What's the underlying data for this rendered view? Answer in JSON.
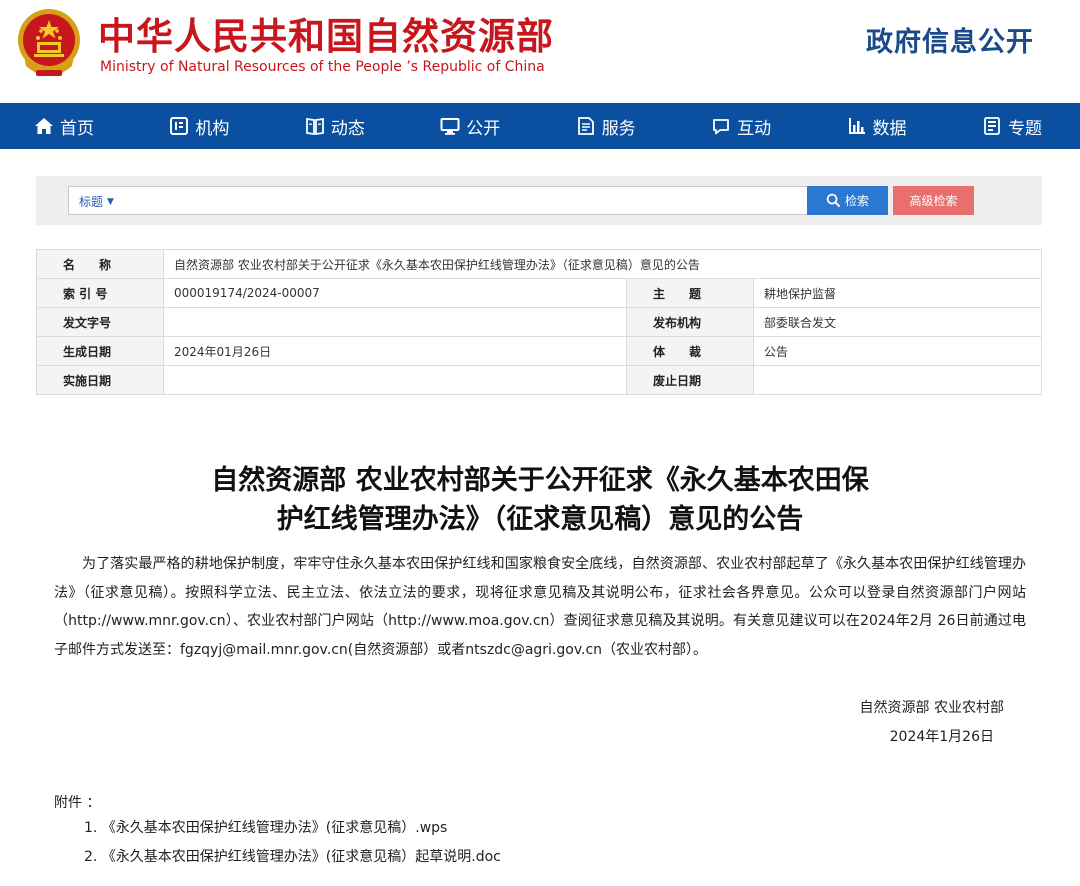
{
  "header": {
    "title": "中华人民共和国自然资源部",
    "subtitle": "Ministry of Natural Resources of the People ’s Republic of China",
    "section": "政府信息公开"
  },
  "nav": {
    "items": [
      {
        "label": "首页",
        "icon": "home-icon"
      },
      {
        "label": "机构",
        "icon": "org-icon"
      },
      {
        "label": "动态",
        "icon": "news-icon"
      },
      {
        "label": "公开",
        "icon": "monitor-icon"
      },
      {
        "label": "服务",
        "icon": "service-icon"
      },
      {
        "label": "互动",
        "icon": "chat-icon"
      },
      {
        "label": "数据",
        "icon": "chart-icon"
      },
      {
        "label": "专题",
        "icon": "topic-icon"
      }
    ]
  },
  "search": {
    "scope": "标题",
    "value": "",
    "search_label": "检索",
    "advanced_label": "高级检索"
  },
  "meta": {
    "name_key": "名　　称",
    "name_value": "自然资源部 农业农村部关于公开征求《永久基本农田保护红线管理办法》（征求意见稿）意见的公告",
    "index_key": "索 引 号",
    "index_value": "000019174/2024-00007",
    "subject_key": "主　　题",
    "subject_value": "耕地保护监督",
    "docno_key": "发文字号",
    "docno_value": "",
    "issuer_key": "发布机构",
    "issuer_value": "部委联合发文",
    "created_key": "生成日期",
    "created_value": "2024年01月26日",
    "genre_key": "体　　裁",
    "genre_value": "公告",
    "effective_key": "实施日期",
    "effective_value": "",
    "repeal_key": "废止日期",
    "repeal_value": ""
  },
  "article": {
    "title_line1": "自然资源部 农业农村部关于公开征求《永久基本农田保",
    "title_line2": "护红线管理办法》（征求意见稿）意见的公告",
    "body": "为了落实最严格的耕地保护制度，牢牢守住永久基本农田保护红线和国家粮食安全底线，自然资源部、农业农村部起草了《永久基本农田保护红线管理办法》（征求意见稿）。按照科学立法、民主立法、依法立法的要求，现将征求意见稿及其说明公布，征求社会各界意见。公众可以登录自然资源部门户网站（http://www.mnr.gov.cn）、农业农村部门户网站（http://www.moa.gov.cn）查阅征求意见稿及其说明。有关意见建议可以在2024年2月 26日前通过电子邮件方式发送至：fgzqyj@mail.mnr.gov.cn(自然资源部）或者ntszdc@agri.gov.cn（农业农村部）。",
    "sign_org": "自然资源部  农业农村部",
    "sign_date": "2024年1月26日",
    "attachments_label": "附件 ：",
    "attachments": [
      "1. 《永久基本农田保护红线管理办法》(征求意见稿）.wps",
      "2. 《永久基本农田保护红线管理办法》(征求意见稿）起草说明.doc"
    ]
  },
  "colors": {
    "brand_red": "#c8161d",
    "nav_blue": "#0b4fa0",
    "search_blue": "#2b77d2",
    "advanced_red": "#e96f6f"
  }
}
